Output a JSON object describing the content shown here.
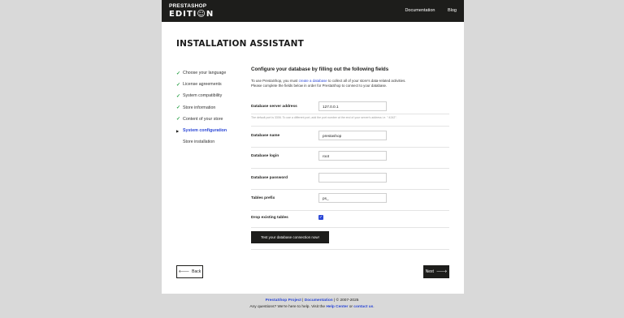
{
  "header": {
    "logo_line1": "PRESTASHOP",
    "logo_line2": "EDITI☺N",
    "nav": [
      "Documentation",
      "Blog"
    ]
  },
  "page_title": "INSTALLATION ASSISTANT",
  "steps": [
    {
      "label": "Choose your language",
      "status": "done"
    },
    {
      "label": "License agreements",
      "status": "done"
    },
    {
      "label": "System compatibility",
      "status": "done"
    },
    {
      "label": "Store information",
      "status": "done"
    },
    {
      "label": "Content of your store",
      "status": "done"
    },
    {
      "label": "System configuration",
      "status": "current"
    },
    {
      "label": "Store installation",
      "status": "pending"
    }
  ],
  "form": {
    "heading": "Configure your database by filling out the following fields",
    "intro_pre": "To use PrestaShop, you must ",
    "intro_link": "create a database",
    "intro_post": " to collect all of your store's data-related activities.",
    "intro_line2": "Please complete the fields below in order for PrestaShop to connect to your database.",
    "server_label": "Database server address",
    "server_value": "127.0.0.1",
    "server_hint": "The default port is 3306. To use a different port, add the port number at the end of your server's address i.e. \":4242\".",
    "name_label": "Database name",
    "name_value": "prestashop",
    "login_label": "Database login",
    "login_value": "root",
    "password_label": "Database password",
    "password_value": "",
    "prefix_label": "Tables prefix",
    "prefix_value": "ps_",
    "drop_label": "Drop existing tables",
    "drop_checked": true,
    "test_button": "Test your database connection now!"
  },
  "nav_buttons": {
    "back": "Back",
    "next": "Next"
  },
  "footer": {
    "project": "PrestaShop Project",
    "sep1": " | ",
    "documentation": "Documentation",
    "copyright": " | © 2007-2025",
    "question": "Any questions? We're here to help. Visit the ",
    "help_center": "Help Center",
    "or": " or ",
    "contact": "contact us",
    "period": "."
  }
}
